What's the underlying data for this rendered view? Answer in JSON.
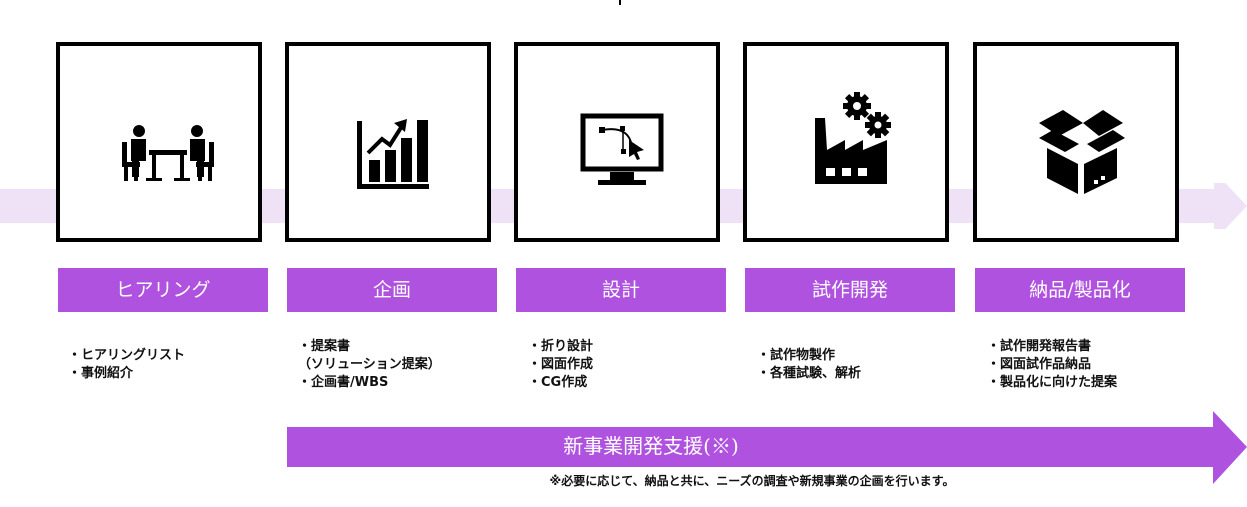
{
  "colors": {
    "accent": "#b052e0",
    "flow_band": "#efe2f7"
  },
  "steps": [
    {
      "id": "hearing",
      "icon": "meeting-icon",
      "label": "ヒアリング",
      "items": [
        "・ヒアリングリスト",
        "・事例紹介"
      ]
    },
    {
      "id": "planning",
      "icon": "growth-chart-icon",
      "label": "企画",
      "items": [
        "・提案書",
        "（ソリューション提案）",
        "・企画書/WBS"
      ]
    },
    {
      "id": "design",
      "icon": "vector-design-monitor-icon",
      "label": "設計",
      "items": [
        "・折り設計",
        "・図面作成",
        "・CG作成"
      ]
    },
    {
      "id": "prototype",
      "icon": "factory-gears-icon",
      "label": "試作開発",
      "items": [
        "・試作物製作",
        "・各種試験、解析"
      ]
    },
    {
      "id": "delivery",
      "icon": "open-box-icon",
      "label": "納品/製品化",
      "items": [
        "・試作開発報告書",
        "・図面試作品納品",
        "・製品化に向けた提案"
      ]
    }
  ],
  "support": {
    "label": "新事業開発支援(※)",
    "note": "※必要に応じて、納品と共に、ニーズの調査や新規事業の企画を行います。"
  }
}
